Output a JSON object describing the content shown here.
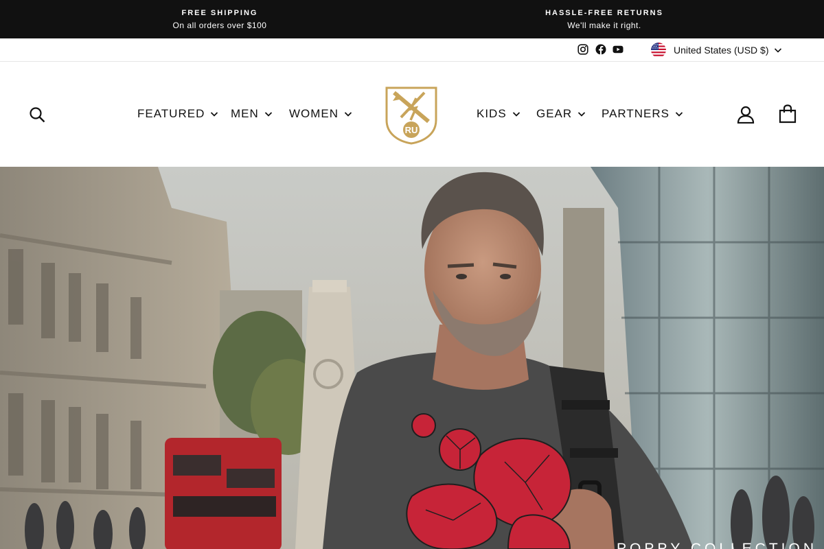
{
  "announcement": {
    "left": {
      "title": "FREE SHIPPING",
      "subtitle": "On all orders over $100"
    },
    "right": {
      "title": "HASSLE-FREE RETURNS",
      "subtitle": "We'll make it right."
    }
  },
  "utility": {
    "social": [
      "instagram-icon",
      "facebook-icon",
      "youtube-icon"
    ],
    "currency_label": "United States (USD $)"
  },
  "nav": {
    "left": [
      "FEATURED",
      "MEN",
      "WOMEN"
    ],
    "right": [
      "KIDS",
      "GEAR",
      "PARTNERS"
    ],
    "logo_text": "RU"
  },
  "header_icons": [
    "search-icon",
    "account-icon",
    "cart-icon"
  ],
  "hero": {
    "caption": "POPPY COLLECTION"
  },
  "colors": {
    "announcement_bg": "#111111",
    "logo_gold": "#C8A45A",
    "poppy_red": "#C72438",
    "shirt_gray": "#4A4A4A"
  }
}
